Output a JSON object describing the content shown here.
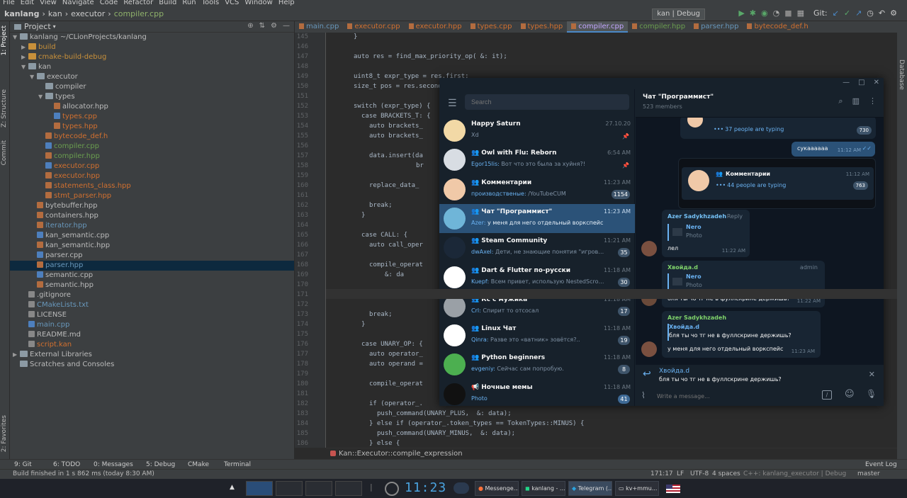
{
  "ide": {
    "menu": [
      "File",
      "Edit",
      "View",
      "Navigate",
      "Code",
      "Refactor",
      "Build",
      "Run",
      "Tools",
      "VCS",
      "Window",
      "Help"
    ],
    "breadcrumb": [
      "kanlang",
      "kan",
      "executor",
      "compiler.cpp"
    ],
    "run_config": "kan | Debug",
    "git_label": "Git:",
    "project_label": "Project",
    "side_labels": {
      "project": "1: Project",
      "structure": "Z: Structure",
      "commit": "Commit",
      "favorites": "2: Favorites",
      "database": "Database"
    },
    "tree": [
      {
        "d": 0,
        "name": "kanlang ~/CLionProjects/kanlang",
        "type": "fold",
        "open": true,
        "color": "#bbb"
      },
      {
        "d": 1,
        "name": "build",
        "type": "fold-o",
        "open": false,
        "color": "#c8903a"
      },
      {
        "d": 1,
        "name": "cmake-build-debug",
        "type": "fold-o",
        "open": false,
        "color": "#c8903a"
      },
      {
        "d": 1,
        "name": "kan",
        "type": "fold",
        "open": true,
        "color": "#bbb"
      },
      {
        "d": 2,
        "name": "executor",
        "type": "fold",
        "open": true,
        "color": "#bbb"
      },
      {
        "d": 3,
        "name": "compiler",
        "type": "fold",
        "open": null,
        "color": "#bbb"
      },
      {
        "d": 3,
        "name": "types",
        "type": "fold",
        "open": true,
        "color": "#bbb"
      },
      {
        "d": 4,
        "name": "allocator.hpp",
        "type": "h",
        "color": "#bbb"
      },
      {
        "d": 4,
        "name": "types.cpp",
        "type": "c",
        "color": "#d2702f"
      },
      {
        "d": 4,
        "name": "types.hpp",
        "type": "h",
        "color": "#d2702f"
      },
      {
        "d": 3,
        "name": "bytecode_def.h",
        "type": "h",
        "color": "#d2702f"
      },
      {
        "d": 3,
        "name": "compiler.cpp",
        "type": "c",
        "color": "#6a9e4f"
      },
      {
        "d": 3,
        "name": "compiler.hpp",
        "type": "h",
        "color": "#6a9e4f"
      },
      {
        "d": 3,
        "name": "executor.cpp",
        "type": "c",
        "color": "#d2702f"
      },
      {
        "d": 3,
        "name": "executor.hpp",
        "type": "h",
        "color": "#d2702f"
      },
      {
        "d": 3,
        "name": "statements_class.hpp",
        "type": "h",
        "color": "#d2702f"
      },
      {
        "d": 3,
        "name": "stmt_parser.hpp",
        "type": "h",
        "color": "#d2702f"
      },
      {
        "d": 2,
        "name": "bytebuffer.hpp",
        "type": "h",
        "color": "#bbb"
      },
      {
        "d": 2,
        "name": "containers.hpp",
        "type": "h",
        "color": "#bbb"
      },
      {
        "d": 2,
        "name": "iterator.hpp",
        "type": "h",
        "color": "#6897bb"
      },
      {
        "d": 2,
        "name": "kan_semantic.cpp",
        "type": "c",
        "color": "#bbb"
      },
      {
        "d": 2,
        "name": "kan_semantic.hpp",
        "type": "h",
        "color": "#bbb"
      },
      {
        "d": 2,
        "name": "parser.cpp",
        "type": "c",
        "color": "#bbb"
      },
      {
        "d": 2,
        "name": "parser.hpp",
        "type": "h",
        "color": "#6897bb",
        "sel": true
      },
      {
        "d": 2,
        "name": "semantic.cpp",
        "type": "c",
        "color": "#bbb"
      },
      {
        "d": 2,
        "name": "semantic.hpp",
        "type": "h",
        "color": "#bbb"
      },
      {
        "d": 1,
        "name": ".gitignore",
        "type": "t",
        "color": "#bbb"
      },
      {
        "d": 1,
        "name": "CMakeLists.txt",
        "type": "t",
        "color": "#6897bb"
      },
      {
        "d": 1,
        "name": "LICENSE",
        "type": "t",
        "color": "#bbb"
      },
      {
        "d": 1,
        "name": "main.cpp",
        "type": "c",
        "color": "#6897bb"
      },
      {
        "d": 1,
        "name": "README.md",
        "type": "t",
        "color": "#bbb"
      },
      {
        "d": 1,
        "name": "script.kan",
        "type": "t",
        "color": "#d2702f"
      },
      {
        "d": 0,
        "name": "External Libraries",
        "type": "fold",
        "open": false,
        "color": "#bbb"
      },
      {
        "d": 0,
        "name": "Scratches and Consoles",
        "type": "fold",
        "open": null,
        "color": "#bbb"
      }
    ],
    "tabs": [
      {
        "label": "main.cpp",
        "color": "#6897bb"
      },
      {
        "label": "executor.cpp",
        "color": "#d2702f"
      },
      {
        "label": "executor.hpp",
        "color": "#d2702f"
      },
      {
        "label": "types.cpp",
        "color": "#d2702f"
      },
      {
        "label": "types.hpp",
        "color": "#d2702f"
      },
      {
        "label": "compiler.cpp",
        "color": "#c3a6ff",
        "active": true
      },
      {
        "label": "compiler.hpp",
        "color": "#6a9e4f"
      },
      {
        "label": "parser.hpp",
        "color": "#6897bb"
      },
      {
        "label": "bytecode_def.h",
        "color": "#d2702f"
      }
    ],
    "line_numbers": [
      145,
      146,
      147,
      148,
      149,
      150,
      151,
      152,
      153,
      154,
      155,
      156,
      157,
      158,
      159,
      160,
      161,
      162,
      163,
      164,
      165,
      166,
      167,
      168,
      169,
      170,
      171,
      172,
      173,
      174,
      175,
      176,
      177,
      178,
      179,
      180,
      181,
      182,
      183,
      184,
      185,
      186
    ],
    "code": [
      {
        "i": 3,
        "t": "}"
      },
      {
        "i": 0,
        "t": ""
      },
      {
        "i": 3,
        "t": "auto res = find_max_priority_op( &: it);"
      },
      {
        "i": 0,
        "t": ""
      },
      {
        "i": 3,
        "t": "uint8_t expr_type = res.first;"
      },
      {
        "i": 3,
        "t": "size_t pos = res.second;"
      },
      {
        "i": 0,
        "t": ""
      },
      {
        "i": 3,
        "t": "switch (expr_type) {"
      },
      {
        "i": 4,
        "t": "case BRACKETS_T: {"
      },
      {
        "i": 5,
        "t": "auto brackets_"
      },
      {
        "i": 5,
        "t": "auto brackets_"
      },
      {
        "i": 0,
        "t": ""
      },
      {
        "i": 5,
        "t": "data.insert(da"
      },
      {
        "i": 11,
        "t": "br"
      },
      {
        "i": 0,
        "t": ""
      },
      {
        "i": 5,
        "t": "replace_data_"
      },
      {
        "i": 0,
        "t": ""
      },
      {
        "i": 5,
        "t": "break;"
      },
      {
        "i": 4,
        "t": "}"
      },
      {
        "i": 0,
        "t": ""
      },
      {
        "i": 4,
        "t": "case CALL: {"
      },
      {
        "i": 5,
        "t": "auto call_oper"
      },
      {
        "i": 0,
        "t": ""
      },
      {
        "i": 5,
        "t": "compile_operat"
      },
      {
        "i": 7,
        "t": "&: da"
      },
      {
        "i": 0,
        "t": ""
      },
      {
        "i": 0,
        "t": ""
      },
      {
        "i": 0,
        "t": ""
      },
      {
        "i": 5,
        "t": "break;"
      },
      {
        "i": 4,
        "t": "}"
      },
      {
        "i": 0,
        "t": ""
      },
      {
        "i": 4,
        "t": "case UNARY_OP: {"
      },
      {
        "i": 5,
        "t": "auto operator_"
      },
      {
        "i": 5,
        "t": "auto operand ="
      },
      {
        "i": 0,
        "t": ""
      },
      {
        "i": 5,
        "t": "compile_operat"
      },
      {
        "i": 0,
        "t": ""
      },
      {
        "i": 5,
        "t": "if (operator_."
      },
      {
        "i": 6,
        "t": "push_command(UNARY_PLUS,  &: data);"
      },
      {
        "i": 5,
        "t": "} else if (operator_.token_types == TokenTypes::MINUS) {"
      },
      {
        "i": 6,
        "t": "push_command(UNARY_MINUS,  &: data);"
      },
      {
        "i": 5,
        "t": "} else {"
      }
    ],
    "editor_crumb": "Kan::Executor::compile_expression",
    "tools": {
      "git": "9: Git",
      "todo": "6: TODO",
      "messages": "0: Messages",
      "debug": "5: Debug",
      "cmake": "CMake",
      "terminal": "Terminal",
      "event_log": "Event Log"
    },
    "status": {
      "build": "Build finished in 1 s 862 ms (today 8:30 AM)",
      "pos": "171:17",
      "lf": "LF",
      "enc": "UTF-8",
      "indent": "4 spaces",
      "ctx": "C++: kanlang_executor | Debug",
      "branch": "master"
    }
  },
  "telegram": {
    "search_placeholder": "Search",
    "chats": [
      {
        "name": "Happy Saturn",
        "time": "27.10.20",
        "preview": "Xd",
        "group": false,
        "pinned": true,
        "avatar": "#f2d9a6"
      },
      {
        "name": "Owl with Flu: Reborn",
        "time": "6:54 AM",
        "sender": "Egor15lis:",
        "preview": "Вот что это была за хуйня?!",
        "group": true,
        "pinned": true,
        "avatar": "#d8dde3"
      },
      {
        "name": "Комментарии",
        "time": "11:23 AM",
        "sender": "производственые:",
        "preview": "/YouTubeCUM",
        "group": true,
        "badge": "1154",
        "avatar": "#f0c9a8"
      },
      {
        "name": "Чат \"Программист\"",
        "time": "11:23 AM",
        "sender": "Azer:",
        "preview": "у меня для него отдельный воркспейс",
        "group": true,
        "selected": true,
        "avatar": "#6fb5d8"
      },
      {
        "name": "Steam Community",
        "time": "11:21 AM",
        "sender": "dwAxel:",
        "preview": "Дети, не знающие понятия \"игровые у...",
        "group": true,
        "badge": "35",
        "avatar": "#1b2838"
      },
      {
        "name": "Dart & Flutter по-русски",
        "time": "11:18 AM",
        "sender": "Kuepf:",
        "preview": "Всем привет, использую NestedScrollVie...",
        "group": true,
        "badge": "30",
        "avatar": "#ffffff"
      },
      {
        "name": "Кс с мужика",
        "time": "11:18 AM",
        "sender": "Crl:",
        "preview": "Спирит то отсосал",
        "group": true,
        "badge": "17",
        "avatar": "#9aa0a6"
      },
      {
        "name": "Linux Чат",
        "time": "11:18 AM",
        "sender": "Qinra:",
        "preview": "Разве это «ватник» зовётся?..",
        "group": true,
        "badge": "19",
        "avatar": "#ffffff"
      },
      {
        "name": "Python beginners",
        "time": "11:18 AM",
        "sender": "evgeniy:",
        "preview": "Сейчас сам попробую.",
        "group": true,
        "badge": "8",
        "avatar": "#4caf50"
      },
      {
        "name": "Ночные мемы",
        "time": "11:18 AM",
        "sender": "Photo",
        "preview": "",
        "group": false,
        "channel": true,
        "badge": "41",
        "badge_blue": true,
        "avatar": "#111111"
      }
    ],
    "chat": {
      "title": "Чат \"Программист\"",
      "members": "523 members",
      "typing1": "37 people are typing",
      "typing1_badge": "730",
      "outgoing": {
        "text": "сукаааааа",
        "time": "11:12 AM"
      },
      "forward": {
        "title": "Комментарии",
        "time": "11:12 AM",
        "typing": "44 people are typing",
        "badge": "763"
      },
      "m1": {
        "name": "Azer Sadykhzadeh",
        "reply_label": "Reply",
        "reply_name": "Nero",
        "reply_text": "Photo",
        "text": "лел",
        "time": "11:22 AM"
      },
      "m2": {
        "name": "Хвойда.d",
        "admin": "admin",
        "reply_name": "Nero",
        "reply_text": "Photo",
        "text": "бля ты чо тг не в фуллскрине держишь?",
        "time": "11:22 AM"
      },
      "m3": {
        "name": "Azer Sadykhzadeh",
        "reply_name": "Хвойда.d",
        "reply_text": "бля ты чо тг не в фуллскрине держишь?",
        "text": "у меня для него отдельный воркспейс",
        "time": "11:23 AM"
      },
      "replying": {
        "name": "Хвойда.d",
        "text": "бля ты чо тг не в фуллскрине держишь?"
      },
      "input_placeholder": "Write a message..."
    }
  },
  "taskbar": {
    "clock": "11:23",
    "windows": [
      "Messenge...",
      "kanlang - ...",
      "Telegram (...",
      "kv+mmu..."
    ]
  }
}
